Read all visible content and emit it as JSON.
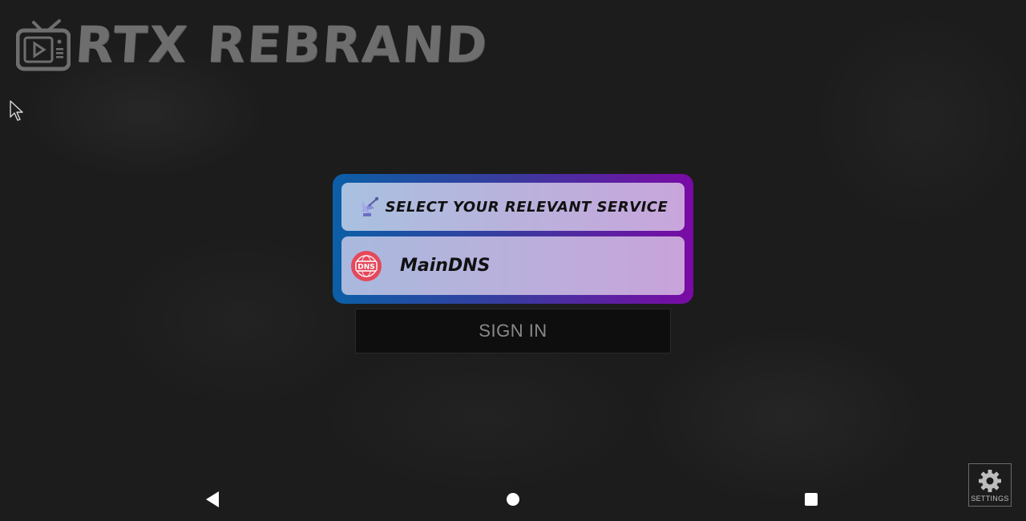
{
  "app": {
    "logo_text": "RTX REBRAND"
  },
  "service_panel": {
    "header_label": "SELECT YOUR RELEVANT SERVICE",
    "header_icon": "satellite-dish-icon",
    "services": [
      {
        "label": "MainDNS",
        "icon": "dns-globe-icon"
      }
    ]
  },
  "actions": {
    "sign_in_label": "SIGN IN",
    "settings_label": "SETTINGS"
  },
  "navigation": {
    "back_icon": "back-triangle-icon",
    "home_icon": "home-circle-icon",
    "recents_icon": "recents-square-icon"
  },
  "colors": {
    "card_gradient_start": "#0b5fa6",
    "card_gradient_end": "#7a0aa4",
    "dns_icon_red": "#e5485b"
  }
}
